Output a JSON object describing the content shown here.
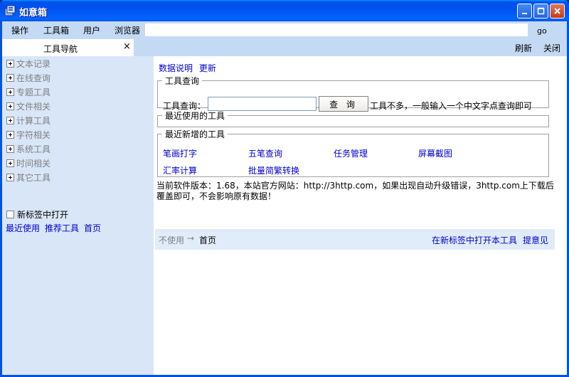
{
  "window": {
    "title": "如意箱"
  },
  "menu": [
    "操作",
    "工具箱",
    "用户",
    "浏览器"
  ],
  "address": {
    "value": "",
    "go_label": "go"
  },
  "tab": {
    "label": "工具导航",
    "close": "×"
  },
  "toolbar": {
    "refresh": "刷新",
    "close": "关闭"
  },
  "sidebar": {
    "items": [
      "文本记录",
      "在线查询",
      "专题工具",
      "文件相关",
      "计算工具",
      "字符相关",
      "系统工具",
      "时间相关",
      "其它工具"
    ],
    "new_tab_checkbox": "新标签中打开",
    "new_tab_checked": false,
    "links": [
      "最近使用",
      "推荐工具",
      "首页"
    ]
  },
  "main": {
    "top_links": [
      "数据说明",
      "更新"
    ],
    "query": {
      "legend": "工具查询",
      "label": "工具查询：",
      "input_value": "",
      "button": "查 询",
      "hint": "工具不多，一般输入一个中文字点查询即可"
    },
    "recent": {
      "legend": "最近使用的工具"
    },
    "newest": {
      "legend": "最近新增的工具",
      "tools": [
        "笔画打字",
        "五笔查询",
        "任务管理",
        "屏幕截图",
        "汇率计算",
        "批量简繁转换"
      ]
    },
    "version_text": "当前软件版本：1.68，本站官方网站：http://3http.com，如果出现自动升级错误，3http.com上下载后覆盖即可，不会影响原有数据！",
    "footer": {
      "muted": "不使用",
      "arrow": "→",
      "home": "首页",
      "open_in_new_tab": "在新标签中打开本工具",
      "feedback": "提意见"
    }
  }
}
